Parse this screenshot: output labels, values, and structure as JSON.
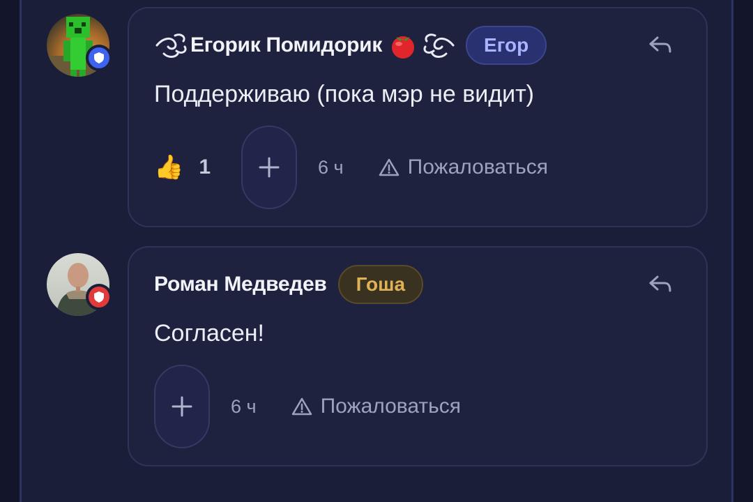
{
  "colors": {
    "page_bg": "#1b1e38",
    "card_bg": "#1f223f",
    "text_primary": "#f2f3f8",
    "text_muted": "#9ea3bd",
    "tag_blue_bg": "#2a3170",
    "tag_blue_text": "#a9b4ff",
    "tag_gold_bg": "#3a3220",
    "tag_gold_text": "#e0b257",
    "badge_blue": "#3d63f0",
    "badge_red": "#e03a3a"
  },
  "comments": [
    {
      "author": "Егорик Помидорик",
      "author_icons": [
        "swirl-icon",
        "tomato-icon",
        "swirl-icon"
      ],
      "tag": "Егор",
      "role_badge": "shield-icon",
      "text": "Поддерживаю (пока мэр не видит)",
      "reaction": {
        "emoji": "👍",
        "count": "1"
      },
      "time": "6 ч",
      "report_label": "Пожаловаться"
    },
    {
      "author": "Роман Медведев",
      "tag": "Гоша",
      "role_badge": "shield-icon",
      "text": "Согласен!",
      "time": "6 ч",
      "report_label": "Пожаловаться"
    }
  ]
}
